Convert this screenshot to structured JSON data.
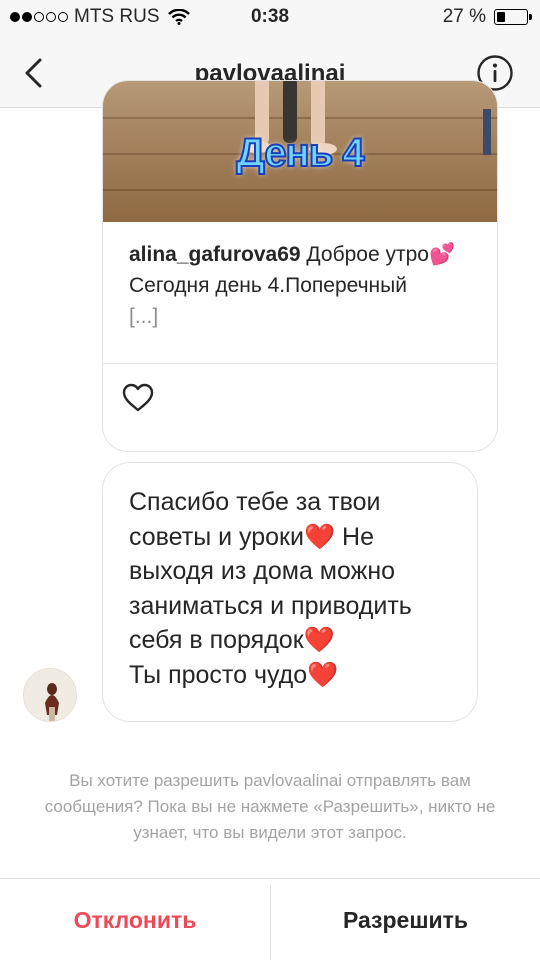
{
  "status_bar": {
    "carrier": "MTS RUS",
    "time": "0:38",
    "battery_percent": "27 %",
    "battery_level": 0.27
  },
  "header": {
    "title": "pavlovaalinai",
    "back_icon": "chevron-left-icon",
    "info_icon": "info-icon"
  },
  "shared_post": {
    "image_label": "День 4",
    "username": "alina_gafurova69",
    "caption_line1": " Доброе утро💕",
    "caption_line2": "Сегодня день 4.Поперечный",
    "more": "[...]",
    "like_icon": "heart-outline-icon"
  },
  "message": {
    "text": "Спасибо тебе за твои советы и уроки❤️  Не выходя из дома можно заниматься и приводить себя в порядок❤️\nТы просто чудо❤️"
  },
  "request": {
    "notice": "Вы хотите разрешить pavlovaalinai отправлять вам сообщения? Пока вы не нажмете «Разрешить», никто не узнает, что вы видели этот запрос."
  },
  "actions": {
    "decline_label": "Отклонить",
    "allow_label": "Разрешить"
  },
  "colors": {
    "decline": "#ed4956",
    "text": "#262626",
    "muted": "#a3a3a3",
    "border": "#e3e3e3"
  }
}
